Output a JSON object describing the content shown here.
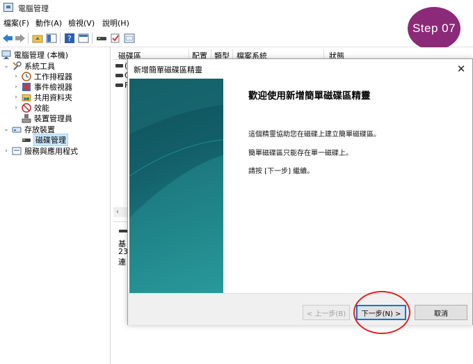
{
  "window": {
    "title": "電腦管理"
  },
  "menu": [
    "檔案(F)",
    "動作(A)",
    "檢視(V)",
    "說明(H)"
  ],
  "toolbar": {
    "icons": [
      "back-arrow-icon",
      "forward-arrow-icon",
      "folder-up-icon",
      "show-pane-icon",
      "help-icon",
      "properties-icon",
      "disk-icon",
      "check-icon",
      "console-icon"
    ]
  },
  "step_badge": "Step 07",
  "tree": {
    "root": "電腦管理 (本機)",
    "items": [
      {
        "label": "系統工具",
        "level": 1,
        "expanded": true
      },
      {
        "label": "工作排程器",
        "level": 2
      },
      {
        "label": "事件檢視器",
        "level": 2
      },
      {
        "label": "共用資料夾",
        "level": 2
      },
      {
        "label": "效能",
        "level": 2
      },
      {
        "label": "裝置管理員",
        "level": 2
      },
      {
        "label": "存放裝置",
        "level": 1,
        "expanded": true
      },
      {
        "label": "磁碟管理",
        "level": 2,
        "selected": true
      },
      {
        "label": "服務與應用程式",
        "level": 1
      }
    ]
  },
  "columns": [
    "磁碟區",
    "配置",
    "類型",
    "檔案系統",
    "狀態"
  ],
  "list_items": [
    "(",
    "C",
    "F"
  ],
  "disk_panel": {
    "lines": [
      "基",
      "23",
      "連"
    ]
  },
  "wizard": {
    "title": "新增簡單磁碟區精靈",
    "heading": "歡迎使用新增簡單磁碟區精靈",
    "para1": "這個精靈協助您在磁碟上建立簡單磁碟區。",
    "para2": "簡單磁碟區只能存在單一磁碟上。",
    "para3": "請按 [下一步] 繼續。",
    "back_label": "< 上一步(B)",
    "next_label": "下一步(N) >",
    "cancel_label": "取消"
  },
  "colors": {
    "badge": "#8b2a78",
    "banner": "#13606a",
    "highlight": "#e02020"
  }
}
